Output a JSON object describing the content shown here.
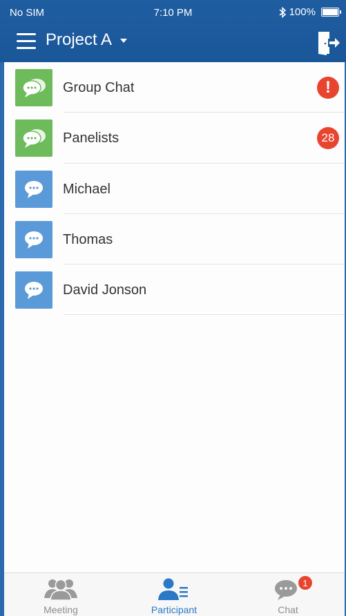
{
  "status": {
    "carrier": "No SIM",
    "time": "7:10 PM",
    "battery": "100%",
    "bluetooth_icon": "bluetooth-icon"
  },
  "header": {
    "title": "Project A",
    "menu_icon": "hamburger-icon",
    "exit_icon": "exit-door-icon"
  },
  "list": [
    {
      "name": "Group  Chat",
      "type": "group",
      "badge": "!",
      "badge_kind": "alert"
    },
    {
      "name": "Panelists",
      "type": "group",
      "badge": "28",
      "badge_kind": "count"
    },
    {
      "name": "Michael",
      "type": "person",
      "badge": ""
    },
    {
      "name": "Thomas",
      "type": "person",
      "badge": ""
    },
    {
      "name": "David Jonson",
      "type": "person",
      "badge": ""
    }
  ],
  "tabs": [
    {
      "label": "Meeting",
      "icon": "people-group-icon",
      "active": false
    },
    {
      "label": "Participant",
      "icon": "participant-list-icon",
      "active": true
    },
    {
      "label": "Chat",
      "icon": "chat-bubble-icon",
      "active": false,
      "badge": "1"
    }
  ],
  "colors": {
    "header": "#1f5da1",
    "group_avatar": "#6dbb5a",
    "person_avatar": "#5b9ad8",
    "badge": "#e8442e",
    "active_tab": "#2a78c6"
  }
}
